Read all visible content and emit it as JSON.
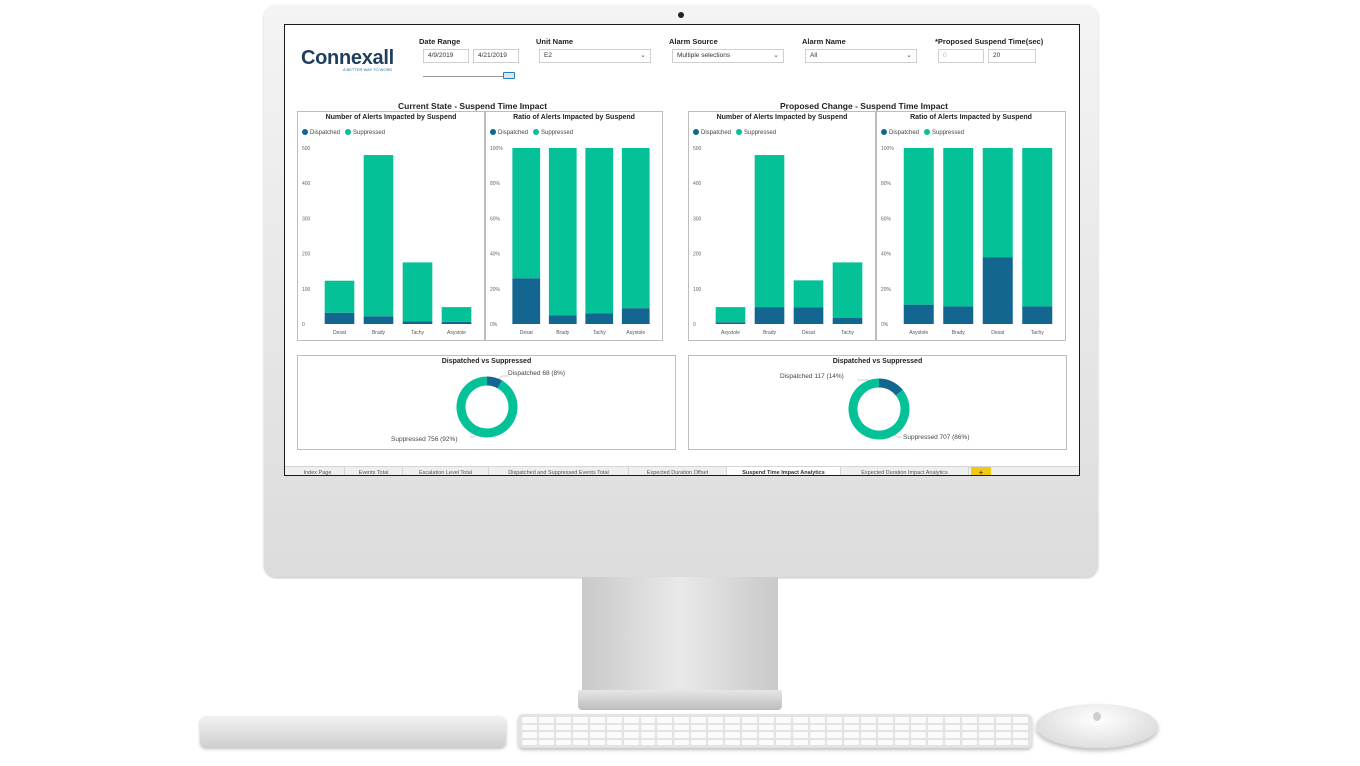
{
  "brand": {
    "name": "Connexall",
    "tagline": "A BETTER WAY TO WORK"
  },
  "colors": {
    "dispatched": "#13668f",
    "suppressed": "#05c197",
    "tab_add": "#f2c811"
  },
  "filters": {
    "date_range": {
      "label": "Date Range",
      "start": "4/9/2019",
      "end": "4/21/2019"
    },
    "unit_name": {
      "label": "Unit Name",
      "value": "E2"
    },
    "alarm_source": {
      "label": "Alarm Source",
      "value": "Multiple selections"
    },
    "alarm_name": {
      "label": "Alarm Name",
      "value": "All"
    },
    "suspend_time": {
      "label": "*Proposed Suspend Time(sec)",
      "min": "0",
      "value": "20"
    }
  },
  "sections": {
    "current": "Current State - Suspend Time Impact",
    "proposed": "Proposed Change - Suspend Time Impact"
  },
  "panel_titles": {
    "count": "Number of Alerts Impacted by Suspend",
    "ratio": "Ratio of Alerts Impacted by Suspend",
    "donut": "Dispatched vs Suppressed"
  },
  "legend": {
    "dispatched": "Dispatched",
    "suppressed": "Suppressed"
  },
  "chart_data": [
    {
      "type": "bar",
      "stacked": true,
      "title": "Number of Alerts Impacted by Suspend",
      "categories": [
        "Desat",
        "Brady",
        "Tachy",
        "Asystole"
      ],
      "series": [
        {
          "name": "Dispatched",
          "values": [
            32,
            22,
            8,
            6
          ]
        },
        {
          "name": "Suppressed",
          "values": [
            91,
            458,
            167,
            42
          ]
        }
      ],
      "ylim": [
        0,
        500
      ],
      "yticks": [
        "0",
        "100",
        "200",
        "300",
        "400",
        "500"
      ],
      "legend": "top-left"
    },
    {
      "type": "bar",
      "stacked": true,
      "title": "Ratio of Alerts Impacted by Suspend",
      "categories": [
        "Desat",
        "Brady",
        "Tachy",
        "Asystole"
      ],
      "series": [
        {
          "name": "Dispatched",
          "values": [
            26,
            5,
            6,
            9
          ]
        },
        {
          "name": "Suppressed",
          "values": [
            74,
            95,
            94,
            91
          ]
        }
      ],
      "ylim": [
        0,
        100
      ],
      "yticks": [
        "0%",
        "20%",
        "40%",
        "60%",
        "80%",
        "100%"
      ],
      "legend": "top-left"
    },
    {
      "type": "pie",
      "title": "Dispatched vs Suppressed",
      "labels": [
        "Dispatched",
        "Suppressed"
      ],
      "values": [
        68,
        756
      ],
      "data_labels": [
        "Dispatched 68 (8%)",
        "Suppressed 756 (92%)"
      ]
    },
    {
      "type": "bar",
      "stacked": true,
      "title": "Number of Alerts Impacted by Suspend",
      "categories": [
        "Asystole",
        "Brady",
        "Desat",
        "Tachy"
      ],
      "series": [
        {
          "name": "Dispatched",
          "values": [
            5,
            48,
            47,
            17
          ]
        },
        {
          "name": "Suppressed",
          "values": [
            43,
            432,
            77,
            158
          ]
        }
      ],
      "ylim": [
        0,
        500
      ],
      "yticks": [
        "0",
        "100",
        "200",
        "300",
        "400",
        "500"
      ],
      "legend": "top-left"
    },
    {
      "type": "bar",
      "stacked": true,
      "title": "Ratio of Alerts Impacted by Suspend",
      "categories": [
        "Asystole",
        "Brady",
        "Desat",
        "Tachy"
      ],
      "series": [
        {
          "name": "Dispatched",
          "values": [
            11,
            10,
            38,
            10
          ]
        },
        {
          "name": "Suppressed",
          "values": [
            89,
            90,
            62,
            90
          ]
        }
      ],
      "ylim": [
        0,
        100
      ],
      "yticks": [
        "0%",
        "20%",
        "40%",
        "60%",
        "80%",
        "100%"
      ],
      "legend": "top-left"
    },
    {
      "type": "pie",
      "title": "Dispatched vs Suppressed",
      "labels": [
        "Dispatched",
        "Suppressed"
      ],
      "values": [
        117,
        707
      ],
      "data_labels": [
        "Dispatched 117 (14%)",
        "Suppressed 707 (86%)"
      ]
    }
  ],
  "tabs": [
    "Index Page",
    "Events Total",
    "Escalation Level Total",
    "Dispatched and Suppressed Events Total",
    "Expected Duration Offset",
    "Suspend Time Impact Analytics",
    "Expected Duration Impact Analytics"
  ],
  "tab_add_label": "+"
}
